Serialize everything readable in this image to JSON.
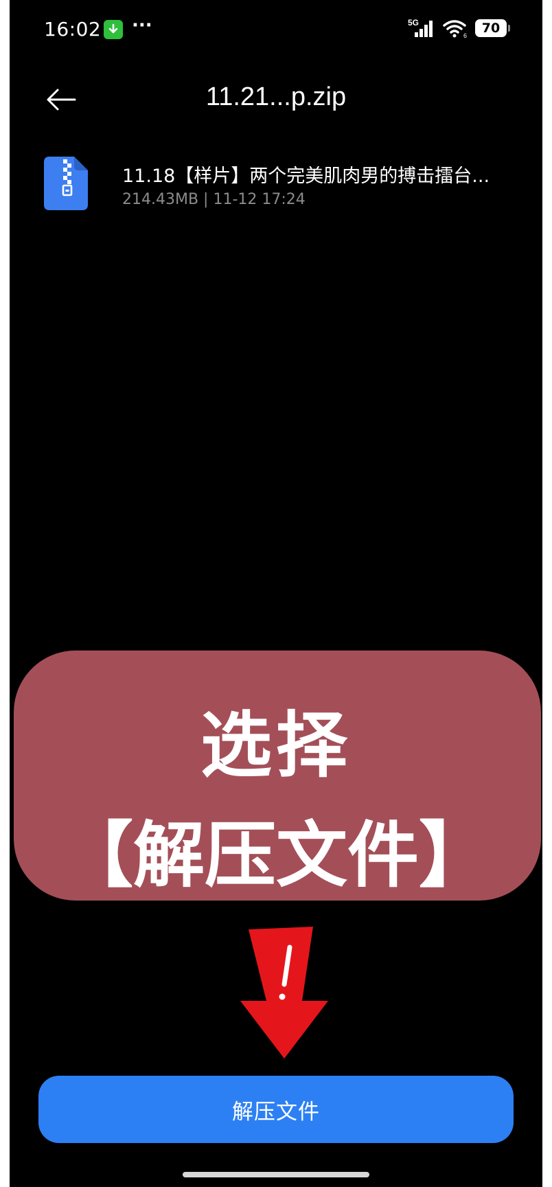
{
  "status_bar": {
    "time": "16:02",
    "overflow": "···",
    "network": "5G",
    "wifi_sub": "6",
    "battery": "70"
  },
  "header": {
    "title": "11.21...p.zip"
  },
  "file": {
    "name": "11.18【样片】两个完美肌肉男的搏击擂台...",
    "meta": "214.43MB | 11-12 17:24",
    "icon": "zip-file-icon"
  },
  "annotation": {
    "line1": "选择",
    "line2": "【解压文件】",
    "arrow": "red-down-arrow"
  },
  "actions": {
    "extract_label": "解压文件"
  },
  "colors": {
    "background": "#000000",
    "accent_blue": "#2d80f3",
    "annotation_card": "#a44f58",
    "arrow_red": "#e4161b",
    "download_badge": "#2fbf3c"
  }
}
